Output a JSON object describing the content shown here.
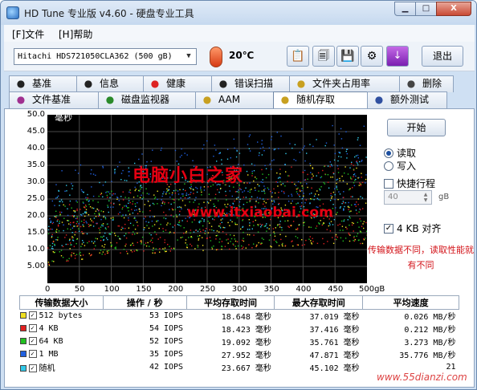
{
  "window": {
    "title": "HD Tune 专业版 v4.60 - 硬盘专业工具",
    "min": "▁",
    "max": "□",
    "close": "X"
  },
  "menu": {
    "file": "[F]文件",
    "help": "[H]帮助"
  },
  "toolbar": {
    "drive": "Hitachi HDS721050CLA362 (500 gB)",
    "temperature": "20℃",
    "exit_label": "退出",
    "icons": [
      "copy-text-icon",
      "copy-screenshot-icon",
      "save-icon",
      "options-icon",
      "download-icon"
    ]
  },
  "tabs_row1": [
    {
      "label": "基准",
      "icon": "benchmark-icon"
    },
    {
      "label": "信息",
      "icon": "info-icon"
    },
    {
      "label": "健康",
      "icon": "health-icon"
    },
    {
      "label": "错误扫描",
      "icon": "error-scan-icon"
    },
    {
      "label": "文件夹占用率",
      "icon": "folder-usage-icon"
    },
    {
      "label": "删除",
      "icon": "erase-icon"
    }
  ],
  "tabs_row2": [
    {
      "label": "文件基准",
      "icon": "file-benchmark-icon"
    },
    {
      "label": "磁盘监视器",
      "icon": "disk-monitor-icon"
    },
    {
      "label": "AAM",
      "icon": "speaker-icon"
    },
    {
      "label": "随机存取",
      "icon": "random-access-icon",
      "active": true
    },
    {
      "label": "额外测试",
      "icon": "extra-tests-icon"
    }
  ],
  "controls": {
    "start": "开始",
    "read": "读取",
    "write": "写入",
    "short_stroke": "快捷行程",
    "short_stroke_value": "40",
    "short_stroke_unit": "gB",
    "align_4kb": "4 KB 对齐",
    "warning": "传输数据不同，读取性能就有不同"
  },
  "chart_data": {
    "type": "scatter",
    "ylabel": "毫秒",
    "xlabel": "",
    "xlim": [
      0,
      500
    ],
    "ylim": [
      0,
      50
    ],
    "x_ticks": [
      "0",
      "50",
      "100",
      "150",
      "200",
      "250",
      "300",
      "350",
      "400",
      "450",
      "500gB"
    ],
    "y_ticks": [
      "5.00",
      "10.0",
      "15.0",
      "20.0",
      "25.0",
      "30.0",
      "35.0",
      "40.0",
      "45.0",
      "50.0"
    ],
    "grid": true,
    "series": [
      {
        "name": "512 bytes",
        "color": "#f0e020",
        "y_min_at_start": 5,
        "y_min_at_end": 12,
        "y_max_at_start": 20,
        "y_max_at_end": 37
      },
      {
        "name": "4 KB",
        "color": "#e02020",
        "y_min_at_start": 5,
        "y_min_at_end": 12,
        "y_max_at_start": 20,
        "y_max_at_end": 37
      },
      {
        "name": "64 KB",
        "color": "#20c020",
        "y_min_at_start": 5,
        "y_min_at_end": 13,
        "y_max_at_start": 21,
        "y_max_at_end": 36
      },
      {
        "name": "1 MB",
        "color": "#2060e0",
        "y_min_at_start": 14,
        "y_min_at_end": 22,
        "y_max_at_start": 30,
        "y_max_at_end": 48
      },
      {
        "name": "随机",
        "color": "#30c8e8",
        "y_min_at_start": 9,
        "y_min_at_end": 18,
        "y_max_at_start": 26,
        "y_max_at_end": 45
      }
    ]
  },
  "results": {
    "headers": [
      "传输数据大小",
      "操作 / 秒",
      "平均存取时间",
      "最大存取时间",
      "平均速度"
    ],
    "rows": [
      {
        "name": "512 bytes",
        "color": "#f0e020",
        "ops": "53 IOPS",
        "avg": "18.648 毫秒",
        "max": "37.019 毫秒",
        "speed": "0.026 MB/秒"
      },
      {
        "name": "4 KB",
        "color": "#e02020",
        "ops": "54 IOPS",
        "avg": "18.423 毫秒",
        "max": "37.416 毫秒",
        "speed": "0.212 MB/秒"
      },
      {
        "name": "64 KB",
        "color": "#20c020",
        "ops": "52 IOPS",
        "avg": "19.092 毫秒",
        "max": "35.761 毫秒",
        "speed": "3.273 MB/秒"
      },
      {
        "name": "1 MB",
        "color": "#2060e0",
        "ops": "35 IOPS",
        "avg": "27.952 毫秒",
        "max": "47.871 毫秒",
        "speed": "35.776 MB/秒"
      },
      {
        "name": "随机",
        "color": "#30c8e8",
        "ops": "42 IOPS",
        "avg": "23.667 毫秒",
        "max": "45.102 毫秒",
        "speed": "21"
      }
    ]
  },
  "watermarks": {
    "cn": "电脑小白之家",
    "url": "www.itxiaobai.com",
    "corner": "www.55dianzi.com"
  }
}
